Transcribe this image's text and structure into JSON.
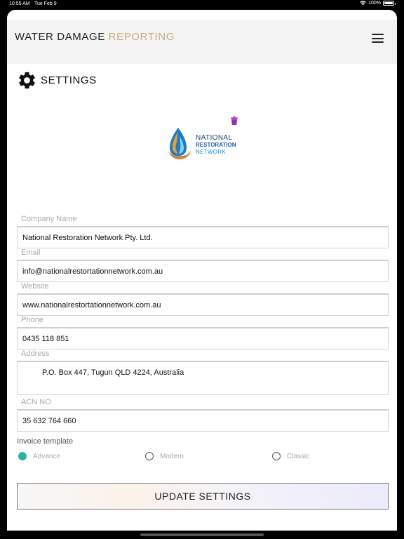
{
  "status_bar": {
    "time": "10:55 AM",
    "date": "Tue Feb 9",
    "battery": "100%"
  },
  "app_bar": {
    "title_primary": "WATER DAMAGE",
    "title_accent": "REPORTING",
    "menu_icon": "hamburger-menu-icon"
  },
  "page": {
    "title": "SETTINGS",
    "icon": "gear-icon"
  },
  "logo": {
    "line1": "NATIONAL",
    "line2": "RESTORATION",
    "line3": "NETWORK",
    "delete_icon": "trash-icon",
    "delete_color": "#9b2cb0"
  },
  "form": {
    "company_name": {
      "label": "Company Name",
      "value": "National Restoration Network Pty. Ltd."
    },
    "email": {
      "label": "Email",
      "value": "info@nationalrestortationnetwork.com.au"
    },
    "website": {
      "label": "Website",
      "value": "www.nationalrestortationnetwork.com.au"
    },
    "phone": {
      "label": "Phone",
      "value": "0435 118 851"
    },
    "address": {
      "label": "Address",
      "value": "P.O. Box 447, Tugun QLD 4224, Australia"
    },
    "acn": {
      "label": "ACN NO",
      "value": "35 632 764 660"
    }
  },
  "invoice_template": {
    "label": "Invoice template",
    "options": [
      "Advance",
      "Modern",
      "Classic"
    ],
    "selected": "Advance",
    "selected_color": "#2bb3a3"
  },
  "update_button": {
    "label": "UPDATE SETTINGS"
  },
  "colors": {
    "accent": "#c8ad7e",
    "app_bar_bg": "#f3f3f3"
  }
}
